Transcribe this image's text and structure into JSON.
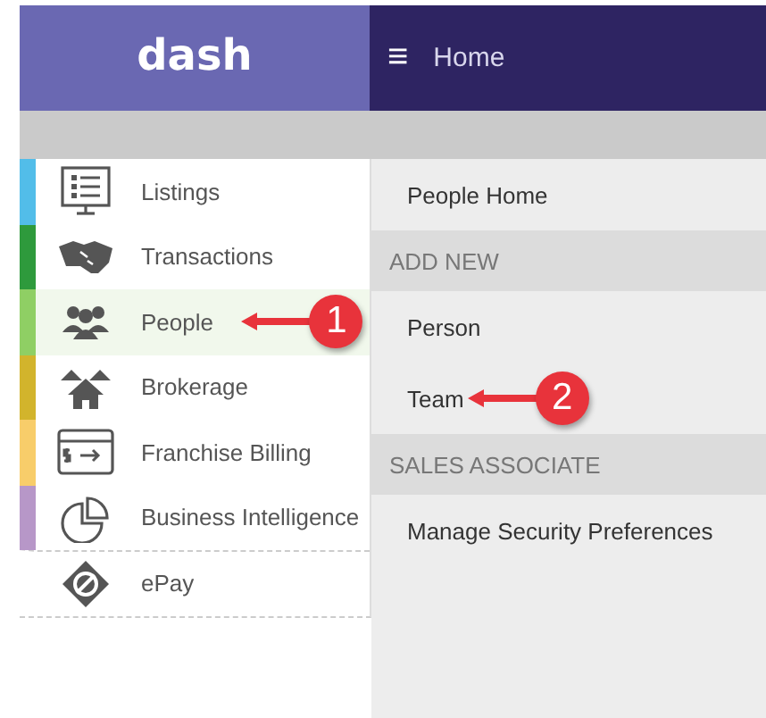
{
  "header": {
    "logo": "dash",
    "menu_icon": "≡",
    "title": "Home"
  },
  "sidebar": {
    "items": [
      {
        "label": "Listings",
        "color": "#52bde9",
        "selected": false
      },
      {
        "label": "Transactions",
        "color": "#2e9a3c",
        "selected": false
      },
      {
        "label": "People",
        "color": "#8fcf64",
        "selected": true,
        "callout": "1"
      },
      {
        "label": "Brokerage",
        "color": "#d2b42c",
        "selected": false
      },
      {
        "label": "Franchise Billing",
        "color": "#f8cd6a",
        "selected": false
      },
      {
        "label": "Business Intelligence",
        "color": "#b797c8",
        "selected": false
      },
      {
        "label": "ePay",
        "selected": false
      }
    ]
  },
  "submenu": {
    "items": [
      {
        "kind": "link",
        "label": "People Home"
      },
      {
        "kind": "heading",
        "label": "ADD NEW"
      },
      {
        "kind": "link",
        "label": "Person"
      },
      {
        "kind": "link",
        "label": "Team",
        "callout": "2"
      },
      {
        "kind": "heading",
        "label": "SALES ASSOCIATE"
      },
      {
        "kind": "link",
        "label": "Manage Security Preferences"
      }
    ]
  }
}
